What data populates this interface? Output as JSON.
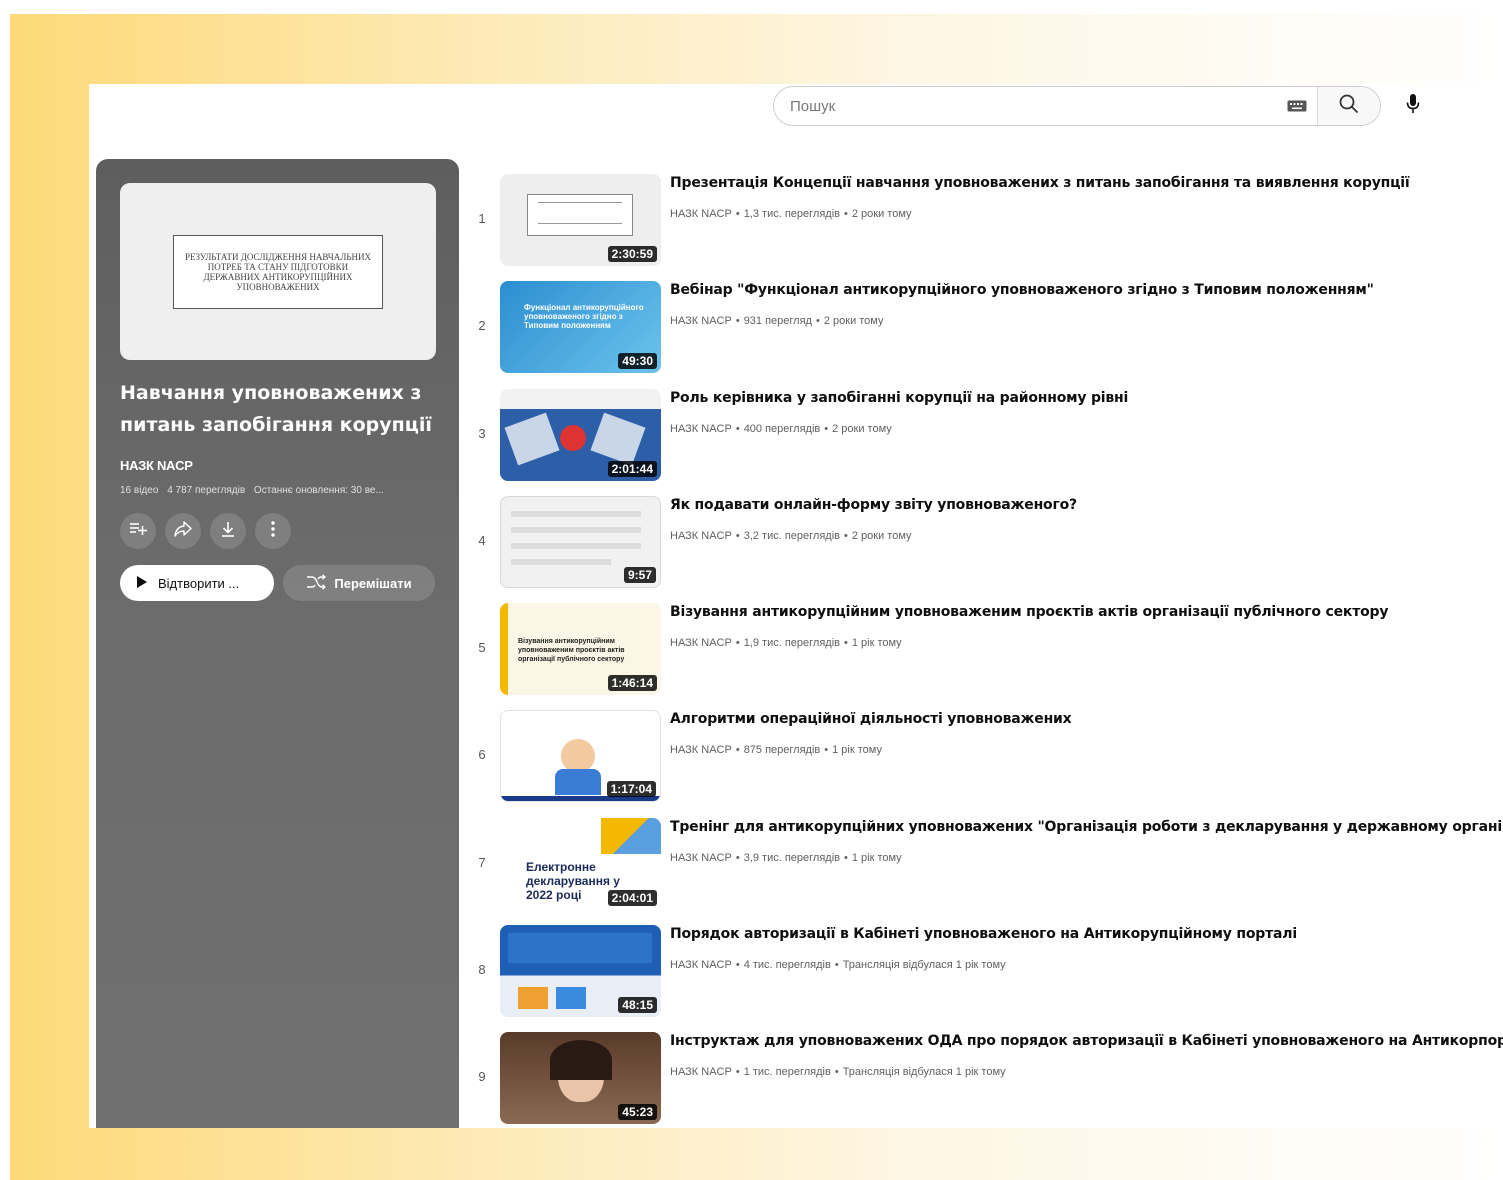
{
  "search": {
    "placeholder": "Пошук"
  },
  "playlist": {
    "thumb_text": "РЕЗУЛЬТАТИ ДОСЛІДЖЕННЯ НАВЧАЛЬНИХ ПОТРЕБ ТА СТАНУ ПІДГОТОВКИ ДЕРЖАВНИХ АНТИКОРУПЦІЙНИХ УПОВНОВАЖЕНИХ",
    "title": "Навчання уповноважених з питань запобігання корупції",
    "channel": "НАЗК NACP",
    "video_count": "16 відео",
    "views": "4 787 переглядів",
    "updated": "Останнє оновлення: 30 ве...",
    "play_label": "Відтворити ...",
    "shuffle_label": "Перемішати"
  },
  "videos": [
    {
      "index": "1",
      "title": "Презентація Концепції навчання уповноважених з питань запобігання та виявлення корупції",
      "channel": "НАЗК NACP",
      "views": "1,3 тис. переглядів",
      "age": "2 роки тому",
      "duration": "2:30:59",
      "thumb_color": "#eeeeee"
    },
    {
      "index": "2",
      "title": "Вебінар \"Функціонал антикорупційного уповноваженого згідно з Типовим положенням\"",
      "channel": "НАЗК NACP",
      "views": "931 перегляд",
      "age": "2 роки тому",
      "duration": "49:30",
      "thumb_color": "#3f9fd3",
      "thumb_text": "Функціонал антикорупційного уповноваженого згідно з Типовим положенням"
    },
    {
      "index": "3",
      "title": "Роль керівника у запобіганні корупції на районному рівні",
      "channel": "НАЗК NACP",
      "views": "400 переглядів",
      "age": "2 роки тому",
      "duration": "2:01:44",
      "thumb_color": "#3b6fb5"
    },
    {
      "index": "4",
      "title": "Як подавати онлайн-форму звіту уповноваженого?",
      "channel": "НАЗК NACP",
      "views": "3,2 тис. переглядів",
      "age": "2 роки тому",
      "duration": "9:57",
      "thumb_color": "#f1f1f1"
    },
    {
      "index": "5",
      "title": "Візування антикорупційним уповноваженим проєктів актів організації публічного сектору",
      "channel": "НАЗК NACP",
      "views": "1,9 тис. переглядів",
      "age": "1 рік тому",
      "duration": "1:46:14",
      "thumb_color": "#fbf6e6",
      "thumb_text": "Візування антикорупційним уповноваженим проєктів актів організації публічного сектору"
    },
    {
      "index": "6",
      "title": "Алгоритми операційної діяльності уповноважених",
      "channel": "НАЗК NACP",
      "views": "875 переглядів",
      "age": "1 рік тому",
      "duration": "1:17:04",
      "thumb_color": "#ffffff"
    },
    {
      "index": "7",
      "title": "Тренінг для антикорупційних уповноважених \"Організація роботи з декларування у державному органі\"",
      "channel": "НАЗК NACP",
      "views": "3,9 тис. переглядів",
      "age": "1 рік тому",
      "duration": "2:04:01",
      "thumb_color": "#ffffff",
      "thumb_text": "Електронне декларування у 2022 році"
    },
    {
      "index": "8",
      "title": "Порядок авторизації в Кабінеті уповноваженого на Антикорупційному порталі",
      "channel": "НАЗК NACP",
      "views": "4 тис. переглядів",
      "age": "Трансляція відбулася 1 рік тому",
      "duration": "48:15",
      "thumb_color": "#1f5fb5"
    },
    {
      "index": "9",
      "title": "Інструктаж для уповноважених ОДА про порядок авторизації в Кабінеті уповноваженого на Антикорпорталі",
      "channel": "НАЗК NACP",
      "views": "1 тис. переглядів",
      "age": "Трансляція відбулася 1 рік тому",
      "duration": "45:23",
      "thumb_color": "#6a4a3a"
    }
  ],
  "colors": {
    "accent_gradient_start": "#fdd978",
    "sidebar_bg": "#666666",
    "duration_bg": "#000000"
  },
  "icons": [
    "keyboard-icon",
    "search-icon",
    "mic-icon",
    "add-to-queue-icon",
    "share-icon",
    "download-icon",
    "more-icon",
    "play-icon",
    "shuffle-icon"
  ]
}
